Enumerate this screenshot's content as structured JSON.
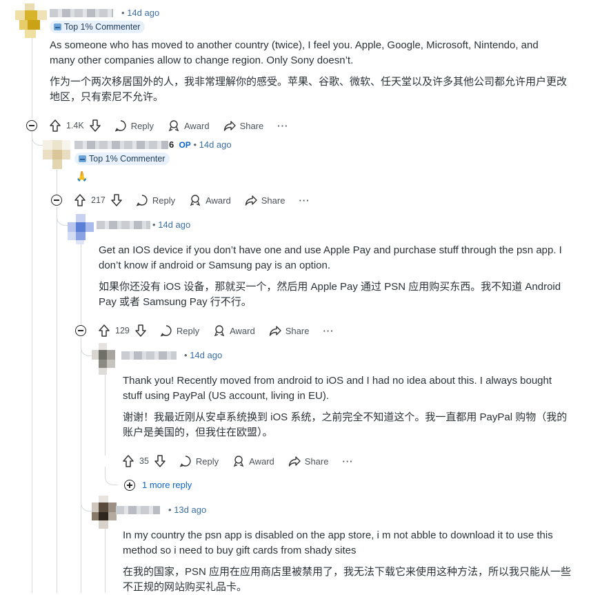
{
  "comments": [
    {
      "id": "c1",
      "time": "14d ago",
      "badge": "Top 1% Commenter",
      "text_en": "As someone who has moved to another country (twice), I feel you. Apple, Google, Microsoft, Nintendo, and many other companies allow to change region. Only Sony doesn’t.",
      "text_zh": "作为一个两次移居国外的人，我非常理解你的感受。苹果、谷歌、微软、任天堂以及许多其他公司都允许用户更改地区，只有索尼不允许。",
      "votes": "1.4K"
    },
    {
      "id": "c2",
      "op_tag": "OP",
      "name_suffix": "6",
      "time": "14d ago",
      "badge": "Top 1% Commenter",
      "emoji": "🙏",
      "votes": "217"
    },
    {
      "id": "c3",
      "time": "14d ago",
      "text_en": "Get an IOS device if you don’t have one and use Apple Pay and purchase stuff through the psn app. I don’t know if android or Samsung pay is an option.",
      "text_zh": "如果你还没有 iOS 设备，那就买一个，然后用 Apple Pay 通过 PSN 应用购买东西。我不知道 Android Pay 或者 Samsung Pay 行不行。",
      "votes": "129"
    },
    {
      "id": "c4",
      "time": "14d ago",
      "text_en": "Thank you! Recently moved from android to iOS and I had no idea about this. I always bought stuff using PayPal (US account, living in EU).",
      "text_zh": "谢谢！我最近刚从安卓系统换到 iOS 系统，之前完全不知道这个。我一直都用 PayPal 购物（我的账户是美国的，但我住在欧盟）。",
      "votes": "35",
      "more_replies": "1 more reply"
    },
    {
      "id": "c5",
      "time": "13d ago",
      "text_en": "In my country the psn app is disabled on the app store, i m not abble to download it to use this method so i need to buy gift cards from shady sites",
      "text_zh": "在我的国家，PSN 应用在应用商店里被禁用了，我无法下载它来使用这种方法，所以我只能从一些不正规的网站购买礼品卡。"
    }
  ],
  "actions": {
    "reply": "Reply",
    "award": "Award",
    "share": "Share",
    "more": "···"
  },
  "meta_separator": "•",
  "colors": {
    "link": "#0a63c9",
    "thread": "#d4d9dc",
    "badge_bg": "#e8f1fb"
  }
}
